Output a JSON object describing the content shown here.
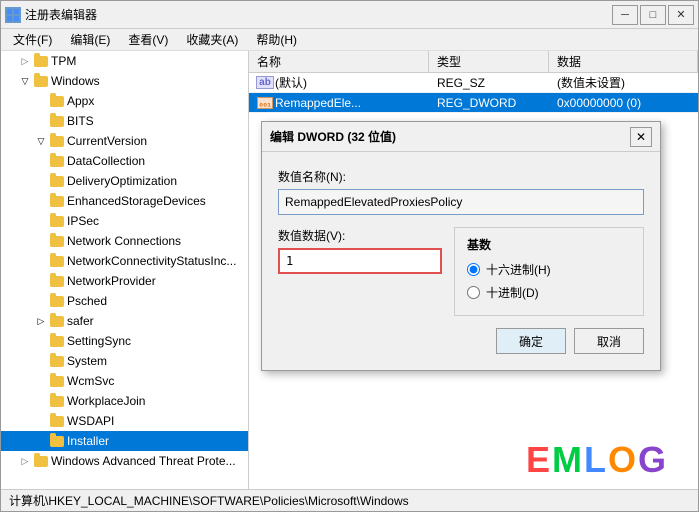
{
  "window": {
    "title": "注册表编辑器",
    "title_icon": "🔑"
  },
  "title_controls": {
    "minimize": "─",
    "maximize": "□",
    "close": "✕"
  },
  "menu": {
    "items": [
      {
        "label": "文件(F)"
      },
      {
        "label": "编辑(E)"
      },
      {
        "label": "查看(V)"
      },
      {
        "label": "收藏夹(A)"
      },
      {
        "label": "帮助(H)"
      }
    ]
  },
  "tree": {
    "items": [
      {
        "id": "tpm",
        "label": "TPM",
        "depth": 1,
        "expanded": false,
        "has_children": false
      },
      {
        "id": "windows",
        "label": "Windows",
        "depth": 1,
        "expanded": true,
        "has_children": true
      },
      {
        "id": "appx",
        "label": "Appx",
        "depth": 2,
        "expanded": false,
        "has_children": false
      },
      {
        "id": "bits",
        "label": "BITS",
        "depth": 2,
        "expanded": false,
        "has_children": false
      },
      {
        "id": "currentversion",
        "label": "CurrentVersion",
        "depth": 2,
        "expanded": true,
        "has_children": true
      },
      {
        "id": "datacollection",
        "label": "DataCollection",
        "depth": 2,
        "expanded": false,
        "has_children": false
      },
      {
        "id": "deliveryoptimization",
        "label": "DeliveryOptimization",
        "depth": 2,
        "expanded": false,
        "has_children": false
      },
      {
        "id": "enhancedstoragedevices",
        "label": "EnhancedStorageDevices",
        "depth": 2,
        "expanded": false,
        "has_children": false
      },
      {
        "id": "ipsec",
        "label": "IPSec",
        "depth": 2,
        "expanded": false,
        "has_children": false
      },
      {
        "id": "networkconnections",
        "label": "Network Connections",
        "depth": 2,
        "expanded": false,
        "has_children": false,
        "selected": false
      },
      {
        "id": "networkconnectivitystatusinc",
        "label": "NetworkConnectivityStatusInc...",
        "depth": 2,
        "expanded": false,
        "has_children": false
      },
      {
        "id": "networkprovider",
        "label": "NetworkProvider",
        "depth": 2,
        "expanded": false,
        "has_children": false
      },
      {
        "id": "psched",
        "label": "Psched",
        "depth": 2,
        "expanded": false,
        "has_children": false
      },
      {
        "id": "safer",
        "label": "safer",
        "depth": 2,
        "expanded": true,
        "has_children": true
      },
      {
        "id": "settingsync",
        "label": "SettingSync",
        "depth": 2,
        "expanded": false,
        "has_children": false
      },
      {
        "id": "system",
        "label": "System",
        "depth": 2,
        "expanded": false,
        "has_children": false
      },
      {
        "id": "wcmsvc",
        "label": "WcmSvc",
        "depth": 2,
        "expanded": false,
        "has_children": false
      },
      {
        "id": "workplacejoin",
        "label": "WorkplaceJoin",
        "depth": 2,
        "expanded": false,
        "has_children": false
      },
      {
        "id": "wsdapi",
        "label": "WSDAPI",
        "depth": 2,
        "expanded": false,
        "has_children": false
      },
      {
        "id": "installer",
        "label": "Installer",
        "depth": 2,
        "expanded": false,
        "has_children": false,
        "selected": true
      },
      {
        "id": "windowsadvancedthreatprote",
        "label": "Windows Advanced Threat Prote...",
        "depth": 0,
        "expanded": false,
        "has_children": true
      }
    ]
  },
  "table": {
    "headers": [
      {
        "id": "name",
        "label": "名称"
      },
      {
        "id": "type",
        "label": "类型"
      },
      {
        "id": "data",
        "label": "数据"
      }
    ],
    "rows": [
      {
        "name": "(默认)",
        "type": "REG_SZ",
        "data": "(数值未设置)",
        "icon": "ab",
        "selected": false
      },
      {
        "name": "RemappedEle...",
        "type": "REG_DWORD",
        "data": "0x00000000 (0)",
        "icon": "dword",
        "selected": true
      }
    ]
  },
  "dialog": {
    "title": "编辑 DWORD (32 位值)",
    "name_label": "数值名称(N):",
    "name_value": "RemappedElevatedProxiesPolicy",
    "value_label": "数值数据(V):",
    "value_input": "1",
    "base_title": "基数",
    "base_options": [
      {
        "label": "十六进制(H)",
        "checked": true
      },
      {
        "label": "十进制(D)",
        "checked": false
      }
    ],
    "ok_button": "确定",
    "cancel_button": "取消",
    "close_btn": "✕"
  },
  "status_bar": {
    "text": "计算机\\HKEY_LOCAL_MACHINE\\SOFTWARE\\Policies\\Microsoft\\Windows"
  },
  "watermark": {
    "letters": [
      "E",
      "M",
      "L",
      "O",
      "G"
    ],
    "colors": [
      "#ff4444",
      "#00cc44",
      "#4488ff",
      "#ff8800",
      "#8844cc"
    ]
  }
}
